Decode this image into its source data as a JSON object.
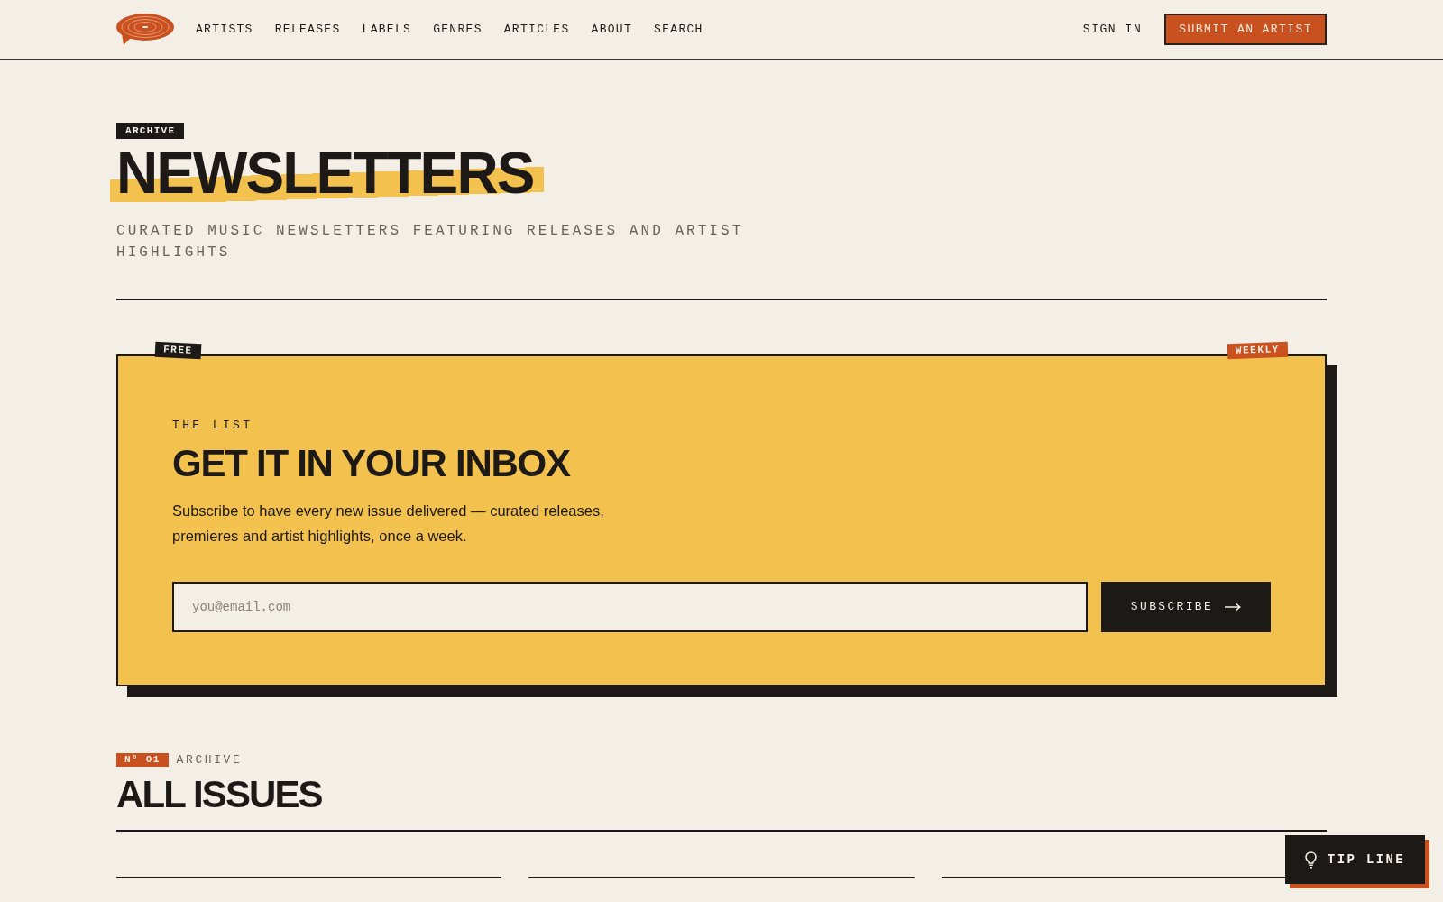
{
  "header": {
    "nav": [
      "ARTISTS",
      "RELEASES",
      "LABELS",
      "GENRES",
      "ARTICLES",
      "ABOUT",
      "SEARCH"
    ],
    "sign_in": "SIGN IN",
    "cta": "SUBMIT AN ARTIST"
  },
  "hero": {
    "tag": "ARCHIVE",
    "title": "NEWSLETTERS",
    "subtitle": "CURATED MUSIC NEWSLETTERS FEATURING RELEASES AND ARTIST HIGHLIGHTS"
  },
  "signup_card": {
    "corner_tags": [
      {
        "label": "FREE",
        "kind": "dark"
      },
      {
        "label": "WEEKLY",
        "kind": "accent"
      }
    ],
    "eyebrow": "THE LIST",
    "title": "GET IT IN YOUR INBOX",
    "description": "Subscribe to have every new issue delivered — curated releases, premieres and artist highlights, once a week.",
    "email_field": {
      "placeholder": "you@email.com"
    },
    "button": "SUBSCRIBE"
  },
  "issues": {
    "number_tag": "N° 01",
    "label": "ARCHIVE",
    "title": "ALL ISSUES"
  },
  "tip_button": "TIP LINE"
}
